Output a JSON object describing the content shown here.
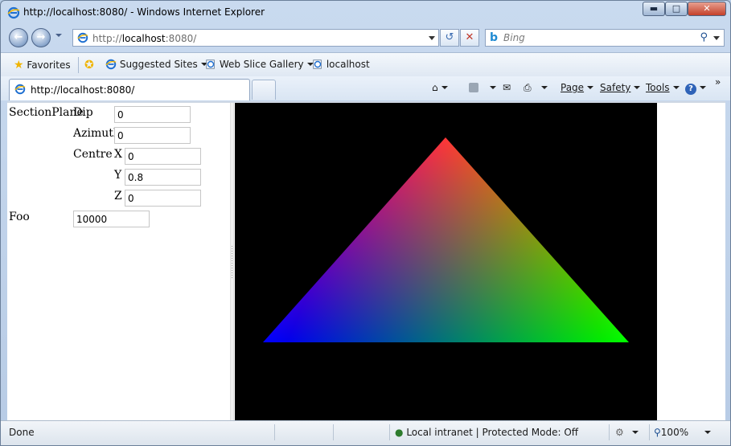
{
  "window": {
    "title": "http://localhost:8080/ - Windows Internet Explorer",
    "minimize_icon": "minimize-icon",
    "maximize_icon": "maximize-icon",
    "close_icon": "close-icon"
  },
  "nav": {
    "address_host_prefix": "http://",
    "address_host": "localhost",
    "address_suffix": ":8080/",
    "search_placeholder": "Bing"
  },
  "favorites_bar": {
    "favorites_label": "Favorites",
    "suggested_sites_label": "Suggested Sites",
    "web_slice_gallery_label": "Web Slice Gallery",
    "localhost_label": "localhost"
  },
  "tab": {
    "title": "http://localhost:8080/"
  },
  "command_bar": {
    "page_label": "Page",
    "safety_label": "Safety",
    "tools_label": "Tools",
    "help_icon": "help-icon"
  },
  "form": {
    "section_plane_label": "SectionPlane",
    "dip_label": "Dip",
    "dip_value": "0",
    "azimuth_label": "Azimuth",
    "azimuth_value": "0",
    "centre_label": "Centre",
    "x_label": "X",
    "x_value": "0",
    "y_label": "Y",
    "y_value": "0.8",
    "z_label": "Z",
    "z_value": "0",
    "foo_label": "Foo",
    "foo_value": "10000"
  },
  "viewport": {
    "background": "#000000",
    "vertex_colors": [
      "#ff0000",
      "#00ff00",
      "#0000ff"
    ]
  },
  "status": {
    "text": "Done",
    "zone": "Local intranet | Protected Mode: Off",
    "zoom": "100%"
  }
}
